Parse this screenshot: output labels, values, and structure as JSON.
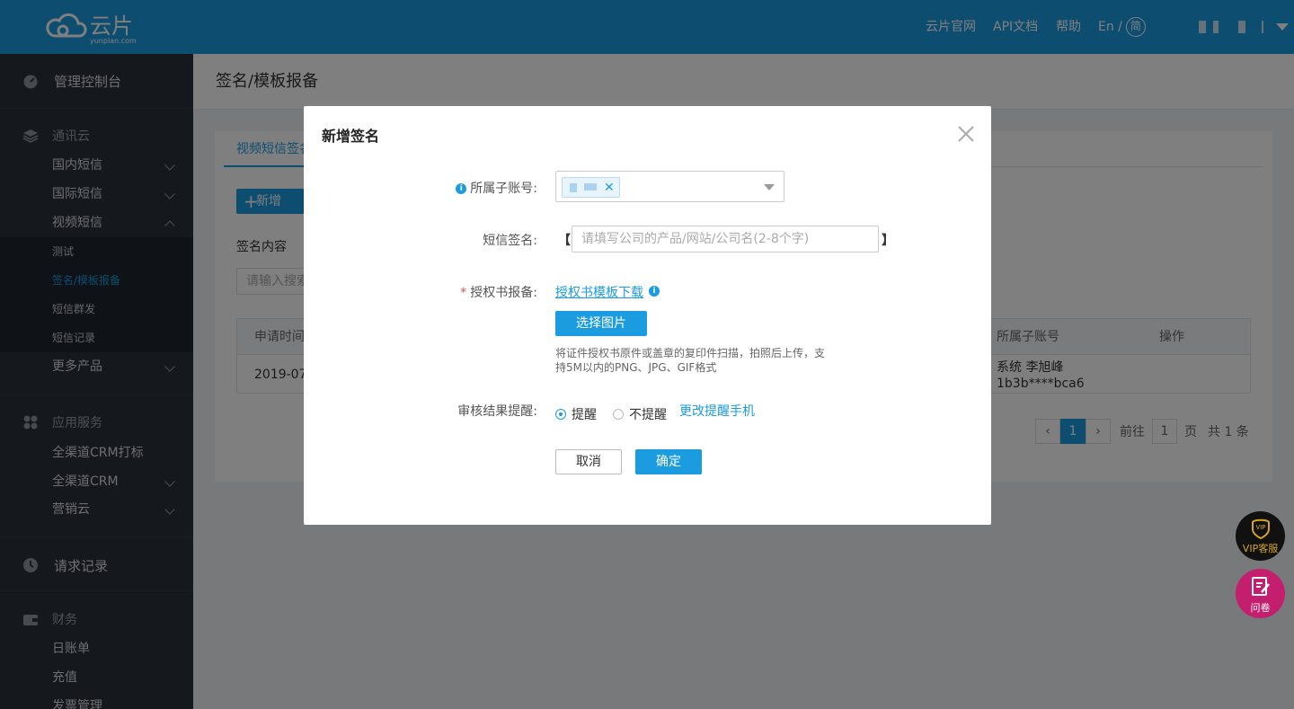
{
  "brand": {
    "name": "云片",
    "domain": "yunpian.com"
  },
  "topnav": {
    "official": "云片官网",
    "api_docs": "API文档",
    "help": "帮助",
    "lang_en": "En /",
    "lang_zh": "简"
  },
  "sidebar": {
    "dashboard": "管理控制台",
    "sec_comm": "通讯云",
    "domestic_sms": "国内短信",
    "intl_sms": "国际短信",
    "video_sms": "视频短信",
    "sub_test": "测试",
    "sub_sign": "签名/模板报备",
    "sub_bulk": "短信群发",
    "sub_records": "短信记录",
    "more": "更多产品",
    "sec_app": "应用服务",
    "crm_call": "全渠道CRM打标",
    "crm": "全渠道CRM",
    "marketing": "营销云",
    "requests": "请求记录",
    "sec_finance": "财务",
    "daily_bill": "日账单",
    "recharge": "充值",
    "invoice": "发票管理"
  },
  "page": {
    "title": "签名/模板报备",
    "tab": "视频短信签名",
    "add_button": "新增",
    "content_label": "签名内容",
    "search_placeholder": "请输入搜索",
    "table": {
      "col_time": "申请时间",
      "col_account": "所属子账号",
      "col_action": "操作",
      "row_time": "2019-07",
      "row_account_1": "系统 李旭峰",
      "row_account_2": "1b3b****bca6"
    },
    "pager": {
      "current": "1",
      "goto": "前往",
      "page_input": "1",
      "page_unit": "页",
      "total": "共 1 条"
    }
  },
  "modal": {
    "title": "新增签名",
    "account_label": "所属子账号:",
    "sign_label": "短信签名:",
    "bracket_left": "【",
    "bracket_right": "】",
    "sign_placeholder": "请填写公司的产品/网站/公司名(2-8个字)",
    "auth_label": "授权书报备:",
    "auth_required": "*",
    "auth_link": "授权书模板下载",
    "pick_button": "选择图片",
    "hint": "将证件授权书原件或盖章的复印件扫描，拍照后上传，支持5M以内的PNG、JPG、GIF格式",
    "remind_label": "审核结果提醒:",
    "remind_on": "提醒",
    "remind_off": "不提醒",
    "change_phone": "更改提醒手机",
    "cancel": "取消",
    "confirm": "确定"
  },
  "floating": {
    "vip": "VIP客服",
    "survey": "问卷"
  },
  "colors": {
    "primary": "#1b9be0",
    "sidebar": "#2b313b",
    "vip_bg": "#111111",
    "vip_gold": "#d4a526",
    "survey_bg": "#c41e6e"
  }
}
